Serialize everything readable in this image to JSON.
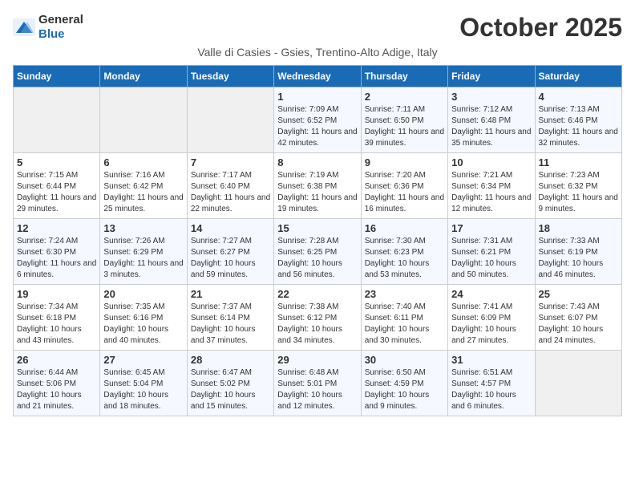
{
  "logo": {
    "general": "General",
    "blue": "Blue"
  },
  "header": {
    "month": "October 2025",
    "subtitle": "Valle di Casies - Gsies, Trentino-Alto Adige, Italy"
  },
  "days_of_week": [
    "Sunday",
    "Monday",
    "Tuesday",
    "Wednesday",
    "Thursday",
    "Friday",
    "Saturday"
  ],
  "weeks": [
    [
      {
        "day": "",
        "info": ""
      },
      {
        "day": "",
        "info": ""
      },
      {
        "day": "",
        "info": ""
      },
      {
        "day": "1",
        "info": "Sunrise: 7:09 AM\nSunset: 6:52 PM\nDaylight: 11 hours and 42 minutes."
      },
      {
        "day": "2",
        "info": "Sunrise: 7:11 AM\nSunset: 6:50 PM\nDaylight: 11 hours and 39 minutes."
      },
      {
        "day": "3",
        "info": "Sunrise: 7:12 AM\nSunset: 6:48 PM\nDaylight: 11 hours and 35 minutes."
      },
      {
        "day": "4",
        "info": "Sunrise: 7:13 AM\nSunset: 6:46 PM\nDaylight: 11 hours and 32 minutes."
      }
    ],
    [
      {
        "day": "5",
        "info": "Sunrise: 7:15 AM\nSunset: 6:44 PM\nDaylight: 11 hours and 29 minutes."
      },
      {
        "day": "6",
        "info": "Sunrise: 7:16 AM\nSunset: 6:42 PM\nDaylight: 11 hours and 25 minutes."
      },
      {
        "day": "7",
        "info": "Sunrise: 7:17 AM\nSunset: 6:40 PM\nDaylight: 11 hours and 22 minutes."
      },
      {
        "day": "8",
        "info": "Sunrise: 7:19 AM\nSunset: 6:38 PM\nDaylight: 11 hours and 19 minutes."
      },
      {
        "day": "9",
        "info": "Sunrise: 7:20 AM\nSunset: 6:36 PM\nDaylight: 11 hours and 16 minutes."
      },
      {
        "day": "10",
        "info": "Sunrise: 7:21 AM\nSunset: 6:34 PM\nDaylight: 11 hours and 12 minutes."
      },
      {
        "day": "11",
        "info": "Sunrise: 7:23 AM\nSunset: 6:32 PM\nDaylight: 11 hours and 9 minutes."
      }
    ],
    [
      {
        "day": "12",
        "info": "Sunrise: 7:24 AM\nSunset: 6:30 PM\nDaylight: 11 hours and 6 minutes."
      },
      {
        "day": "13",
        "info": "Sunrise: 7:26 AM\nSunset: 6:29 PM\nDaylight: 11 hours and 3 minutes."
      },
      {
        "day": "14",
        "info": "Sunrise: 7:27 AM\nSunset: 6:27 PM\nDaylight: 10 hours and 59 minutes."
      },
      {
        "day": "15",
        "info": "Sunrise: 7:28 AM\nSunset: 6:25 PM\nDaylight: 10 hours and 56 minutes."
      },
      {
        "day": "16",
        "info": "Sunrise: 7:30 AM\nSunset: 6:23 PM\nDaylight: 10 hours and 53 minutes."
      },
      {
        "day": "17",
        "info": "Sunrise: 7:31 AM\nSunset: 6:21 PM\nDaylight: 10 hours and 50 minutes."
      },
      {
        "day": "18",
        "info": "Sunrise: 7:33 AM\nSunset: 6:19 PM\nDaylight: 10 hours and 46 minutes."
      }
    ],
    [
      {
        "day": "19",
        "info": "Sunrise: 7:34 AM\nSunset: 6:18 PM\nDaylight: 10 hours and 43 minutes."
      },
      {
        "day": "20",
        "info": "Sunrise: 7:35 AM\nSunset: 6:16 PM\nDaylight: 10 hours and 40 minutes."
      },
      {
        "day": "21",
        "info": "Sunrise: 7:37 AM\nSunset: 6:14 PM\nDaylight: 10 hours and 37 minutes."
      },
      {
        "day": "22",
        "info": "Sunrise: 7:38 AM\nSunset: 6:12 PM\nDaylight: 10 hours and 34 minutes."
      },
      {
        "day": "23",
        "info": "Sunrise: 7:40 AM\nSunset: 6:11 PM\nDaylight: 10 hours and 30 minutes."
      },
      {
        "day": "24",
        "info": "Sunrise: 7:41 AM\nSunset: 6:09 PM\nDaylight: 10 hours and 27 minutes."
      },
      {
        "day": "25",
        "info": "Sunrise: 7:43 AM\nSunset: 6:07 PM\nDaylight: 10 hours and 24 minutes."
      }
    ],
    [
      {
        "day": "26",
        "info": "Sunrise: 6:44 AM\nSunset: 5:06 PM\nDaylight: 10 hours and 21 minutes."
      },
      {
        "day": "27",
        "info": "Sunrise: 6:45 AM\nSunset: 5:04 PM\nDaylight: 10 hours and 18 minutes."
      },
      {
        "day": "28",
        "info": "Sunrise: 6:47 AM\nSunset: 5:02 PM\nDaylight: 10 hours and 15 minutes."
      },
      {
        "day": "29",
        "info": "Sunrise: 6:48 AM\nSunset: 5:01 PM\nDaylight: 10 hours and 12 minutes."
      },
      {
        "day": "30",
        "info": "Sunrise: 6:50 AM\nSunset: 4:59 PM\nDaylight: 10 hours and 9 minutes."
      },
      {
        "day": "31",
        "info": "Sunrise: 6:51 AM\nSunset: 4:57 PM\nDaylight: 10 hours and 6 minutes."
      },
      {
        "day": "",
        "info": ""
      }
    ]
  ]
}
